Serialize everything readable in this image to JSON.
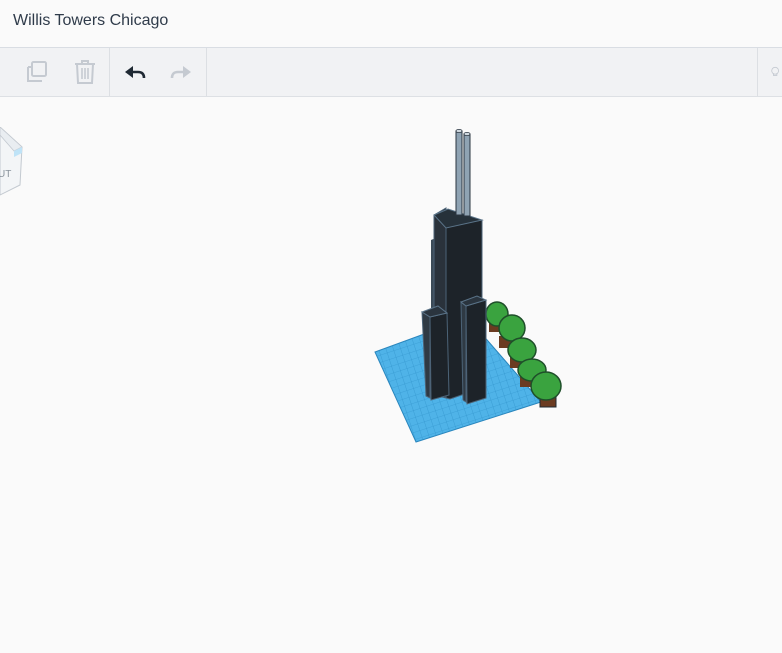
{
  "header": {
    "title": "Willis Towers Chicago"
  },
  "toolbar": {
    "buttons": [
      {
        "name": "copy",
        "icon": "duplicate-icon",
        "enabled": false
      },
      {
        "name": "delete",
        "icon": "trash-icon",
        "enabled": false
      },
      {
        "name": "undo",
        "icon": "undo-arrow-icon",
        "enabled": true
      },
      {
        "name": "redo",
        "icon": "redo-arrow-icon",
        "enabled": false
      },
      {
        "name": "notes",
        "icon": "lightbulb-icon",
        "enabled": false
      }
    ]
  },
  "viewcube": {
    "face_label": "UT"
  },
  "scene": {
    "objects": [
      "workplane-grid",
      "main-tower",
      "antenna-left",
      "antenna-right",
      "left-tower",
      "front-tower",
      "tree-row"
    ],
    "colors": {
      "grid": "#4fb3e8",
      "tower": "#22282f",
      "tree": "#3aa33f",
      "antenna": "#8fa3b3"
    }
  }
}
